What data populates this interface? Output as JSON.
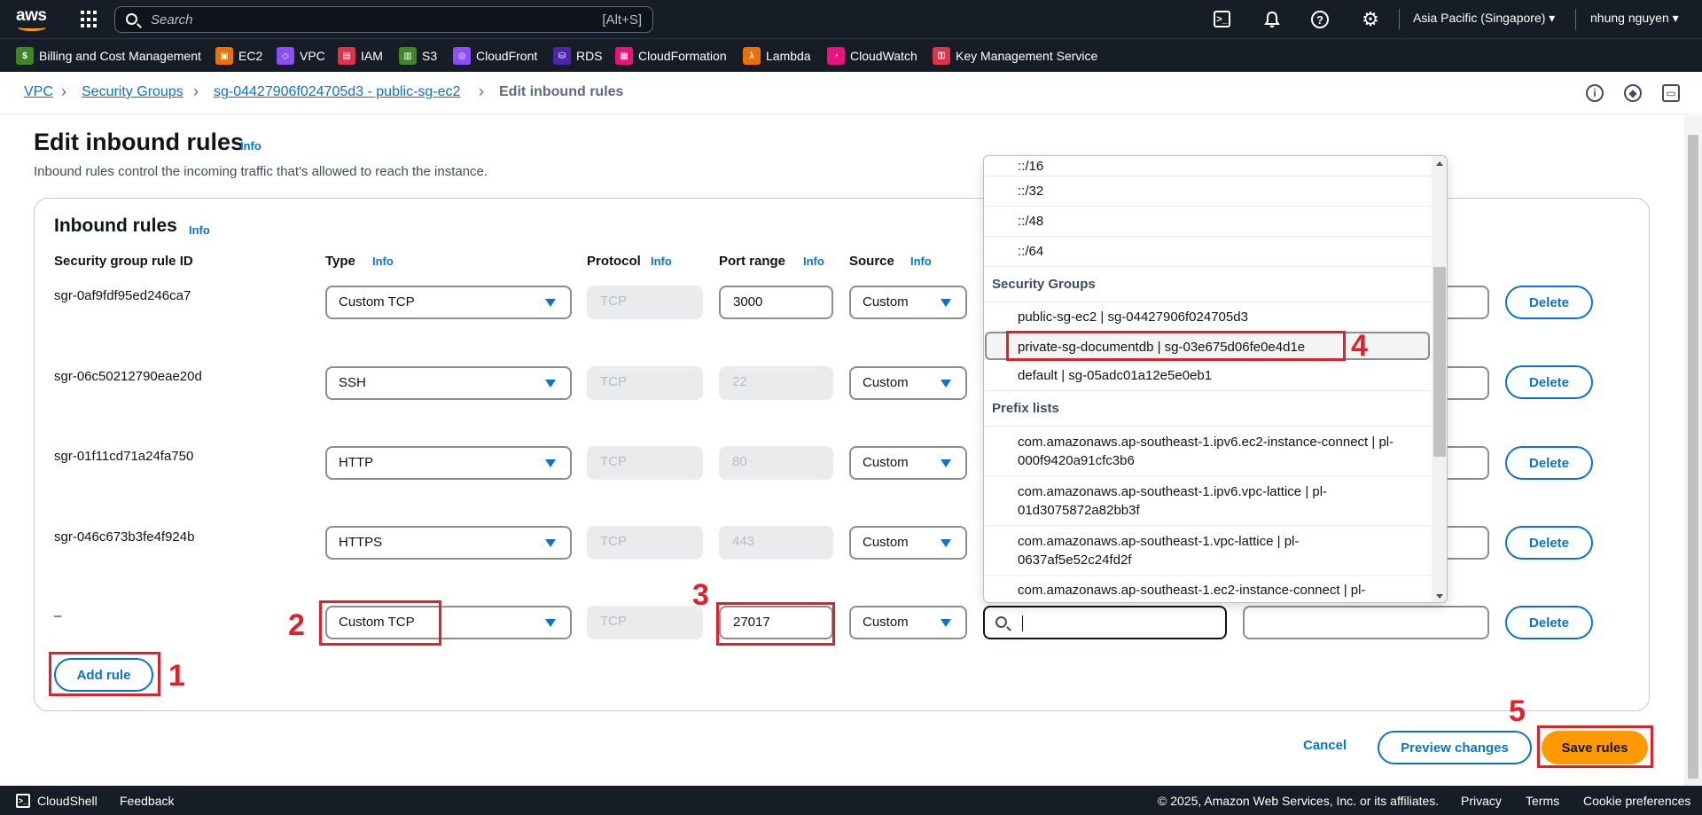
{
  "topnav": {
    "logo_text": "aws",
    "search_placeholder": "Search",
    "search_shortcut": "[Alt+S]",
    "region": "Asia Pacific (Singapore) ▾",
    "user": "nhung nguyen ▾"
  },
  "services": [
    {
      "label": "Billing and Cost Management",
      "color": "#3f8624",
      "icon": "billing-icon"
    },
    {
      "label": "EC2",
      "color": "#ed7100",
      "icon": "ec2-icon"
    },
    {
      "label": "VPC",
      "color": "#8c4fff",
      "icon": "vpc-icon"
    },
    {
      "label": "IAM",
      "color": "#dd344c",
      "icon": "iam-icon"
    },
    {
      "label": "S3",
      "color": "#3f8624",
      "icon": "s3-icon"
    },
    {
      "label": "CloudFront",
      "color": "#8c4fff",
      "icon": "cloudfront-icon"
    },
    {
      "label": "RDS",
      "color": "#4d27aa",
      "icon": "rds-icon"
    },
    {
      "label": "CloudFormation",
      "color": "#e7157b",
      "icon": "cloudformation-icon"
    },
    {
      "label": "Lambda",
      "color": "#ed7100",
      "icon": "lambda-icon"
    },
    {
      "label": "CloudWatch",
      "color": "#e7157b",
      "icon": "cloudwatch-icon"
    },
    {
      "label": "Key Management Service",
      "color": "#dd344c",
      "icon": "kms-icon"
    }
  ],
  "breadcrumb": {
    "items": [
      "VPC",
      "Security Groups",
      "sg-04427906f024705d3 - public-sg-ec2"
    ],
    "current": "Edit inbound rules"
  },
  "page": {
    "title": "Edit inbound rules",
    "info": "Info",
    "description": "Inbound rules control the incoming traffic that's allowed to reach the instance."
  },
  "panel": {
    "title": "Inbound rules",
    "columns": {
      "rule_id": "Security group rule ID",
      "type": "Type",
      "protocol": "Protocol",
      "port_range": "Port range",
      "source": "Source"
    }
  },
  "rules": [
    {
      "id": "sgr-0af9fdf95ed246ca7",
      "type": "Custom TCP",
      "protocol": "TCP",
      "port": "3000",
      "source": "Custom",
      "port_editable": true
    },
    {
      "id": "sgr-06c50212790eae20d",
      "type": "SSH",
      "protocol": "TCP",
      "port": "22",
      "source": "Custom",
      "port_editable": false
    },
    {
      "id": "sgr-01f11cd71a24fa750",
      "type": "HTTP",
      "protocol": "TCP",
      "port": "80",
      "source": "Custom",
      "port_editable": false
    },
    {
      "id": "sgr-046c673b3fe4f924b",
      "type": "HTTPS",
      "protocol": "TCP",
      "port": "443",
      "source": "Custom",
      "port_editable": false
    },
    {
      "id": "–",
      "type": "Custom TCP",
      "protocol": "TCP",
      "port": "27017",
      "source": "Custom",
      "port_editable": true
    }
  ],
  "delete_label": "Delete",
  "add_rule_label": "Add rule",
  "dropdown": {
    "cidr_items": [
      "::/16",
      "::/32",
      "::/48",
      "::/64"
    ],
    "group_security": "Security Groups",
    "security_groups": [
      "public-sg-ec2 | sg-04427906f024705d3",
      "private-sg-documentdb | sg-03e675d06fe0e4d1e",
      "default | sg-05adc01a12e5e0eb1"
    ],
    "group_prefix": "Prefix lists",
    "prefix_lists": [
      "com.amazonaws.ap-southeast-1.ipv6.ec2-instance-connect | pl-000f9420a91cfc3b6",
      "com.amazonaws.ap-southeast-1.ipv6.vpc-lattice | pl-01d3075872a82bb3f",
      "com.amazonaws.ap-southeast-1.vpc-lattice | pl-0637af5e52c24fd2f",
      "com.amazonaws.ap-southeast-1.ec2-instance-connect | pl-"
    ]
  },
  "annotations": [
    "1",
    "2",
    "3",
    "4",
    "5"
  ],
  "actions": {
    "cancel": "Cancel",
    "preview": "Preview changes",
    "save": "Save rules"
  },
  "footer": {
    "cloudshell": "CloudShell",
    "feedback": "Feedback",
    "copyright": "© 2025, Amazon Web Services, Inc. or its affiliates.",
    "privacy": "Privacy",
    "terms": "Terms",
    "cookies": "Cookie preferences"
  }
}
